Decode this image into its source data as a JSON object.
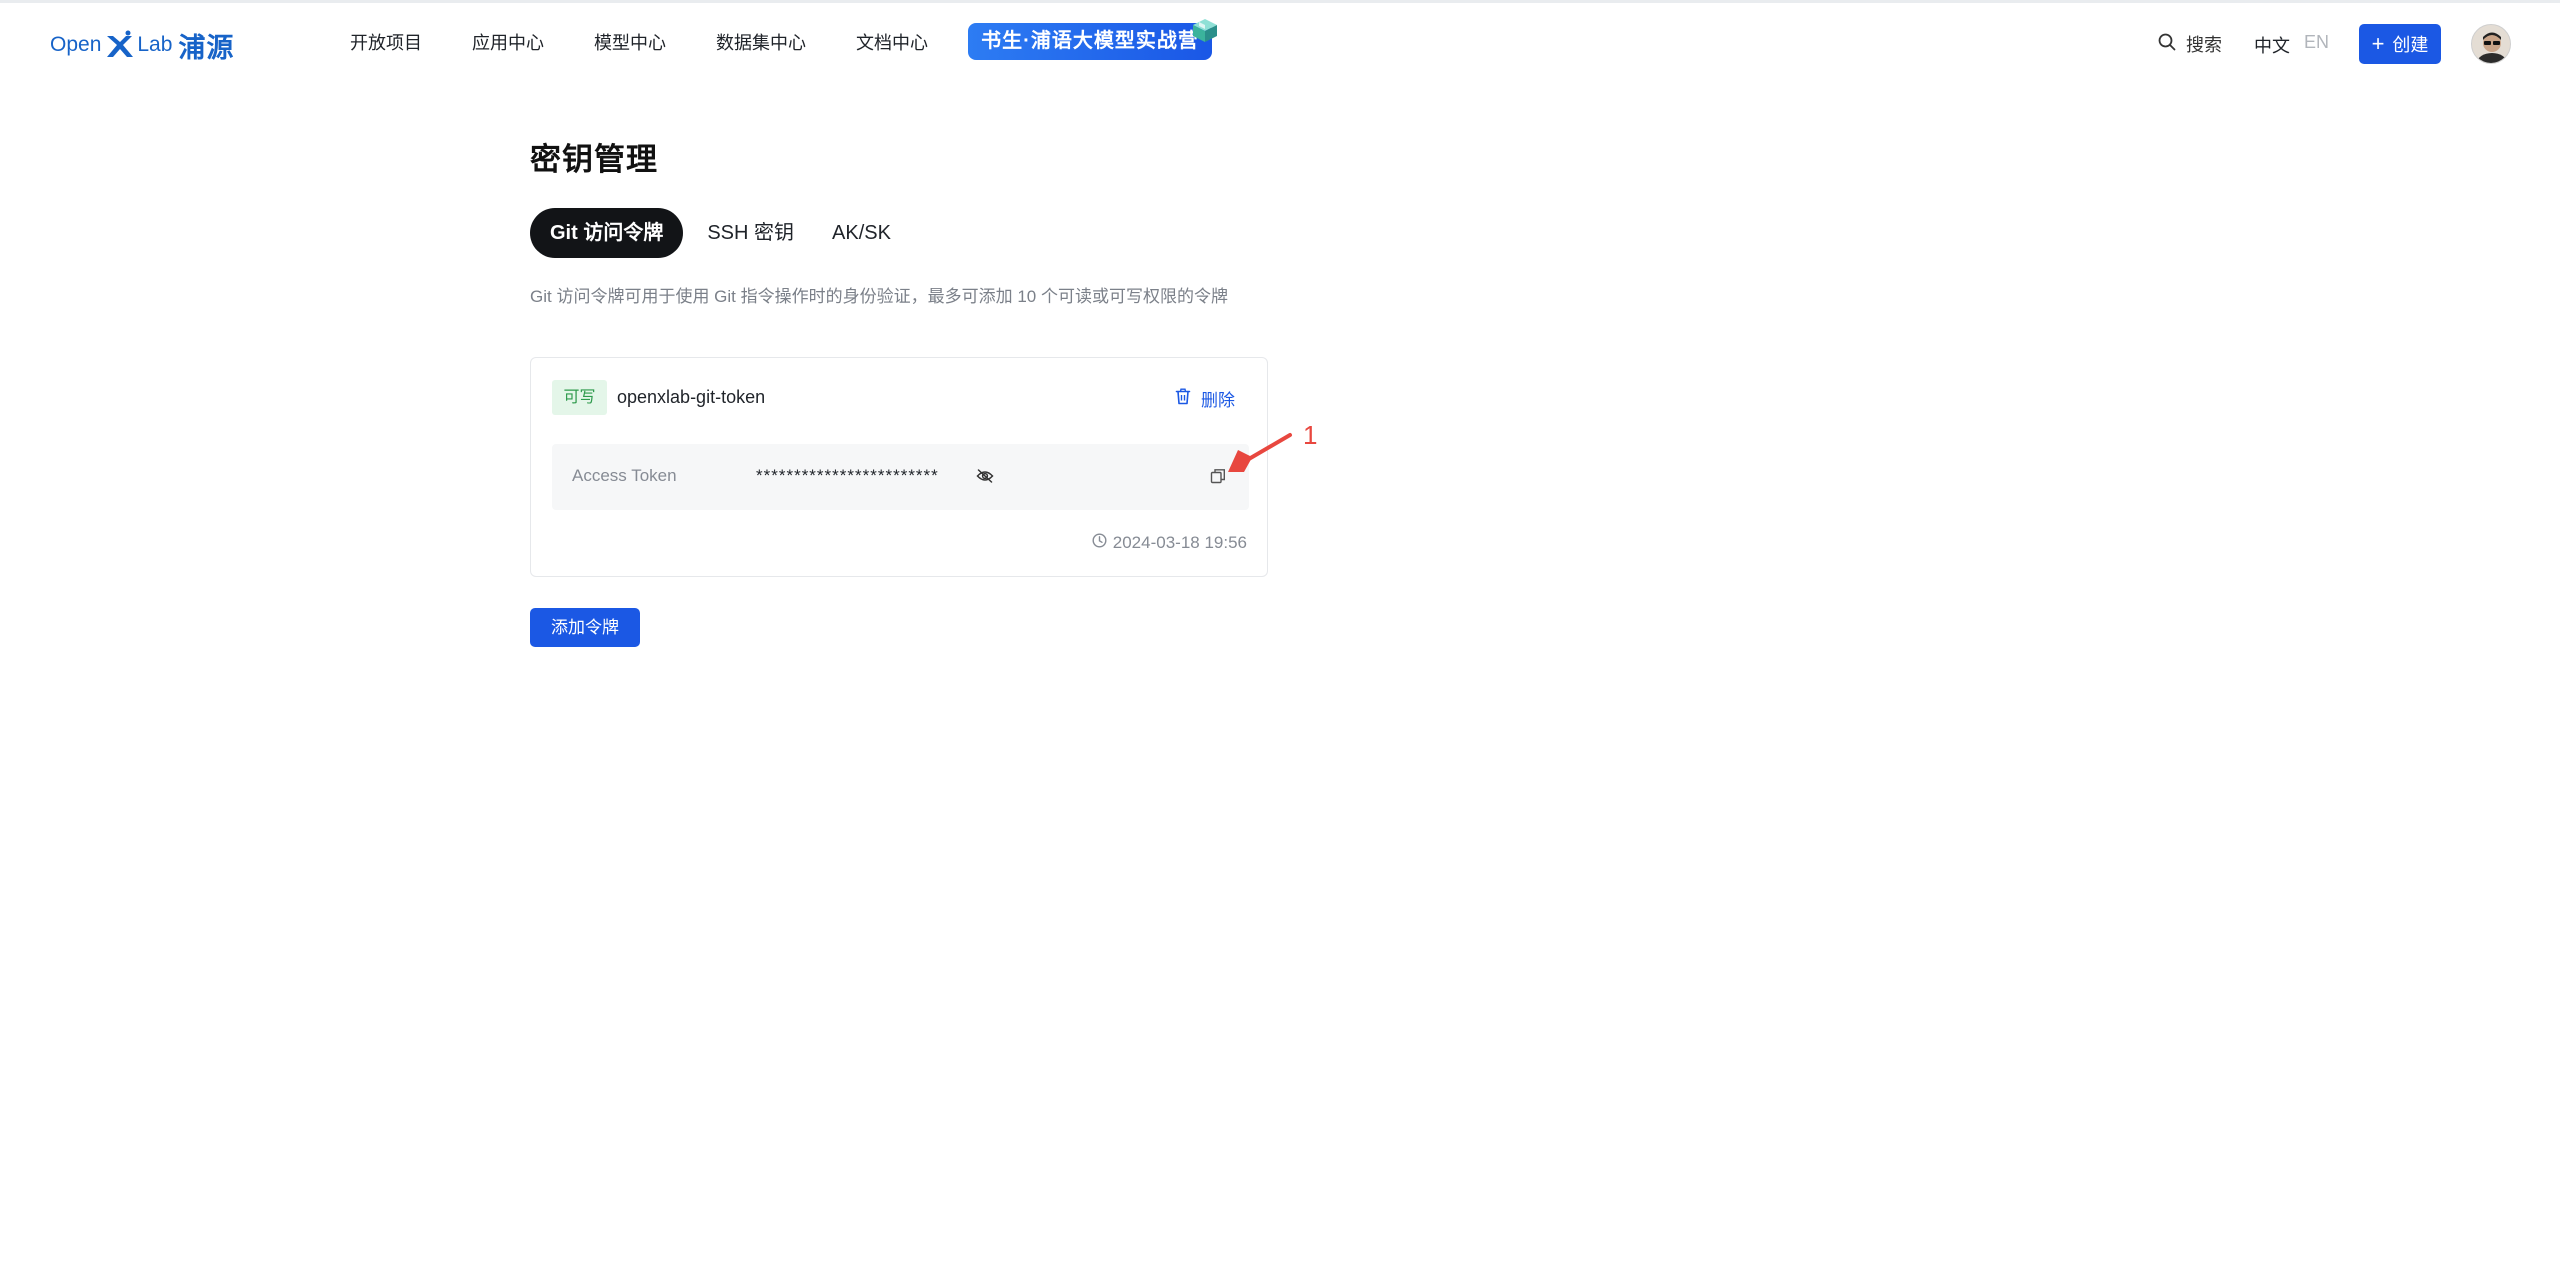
{
  "header": {
    "logo": {
      "open": "Open",
      "lab": "Lab",
      "cn": "浦源"
    },
    "nav": [
      {
        "label": "开放项目"
      },
      {
        "label": "应用中心"
      },
      {
        "label": "模型中心"
      },
      {
        "label": "数据集中心"
      },
      {
        "label": "文档中心"
      }
    ],
    "promo_label": "书生·浦语大模型实战营",
    "search_label": "搜索",
    "lang_zh": "中文",
    "lang_en": "EN",
    "create_label": "创建",
    "create_plus": "+"
  },
  "main": {
    "title": "密钥管理",
    "tabs": [
      {
        "label": "Git 访问令牌",
        "active": true
      },
      {
        "label": "SSH 密钥",
        "active": false
      },
      {
        "label": "AK/SK",
        "active": false
      }
    ],
    "description": "Git 访问令牌可用于使用 Git 指令操作时的身份验证，最多可添加 10 个可读或可写权限的令牌",
    "token": {
      "permission": "可写",
      "name": "openxlab-git-token",
      "delete_label": "删除",
      "access_label": "Access Token",
      "access_value": "************************",
      "created_at": "2024-03-18 19:56"
    },
    "add_button_label": "添加令牌"
  },
  "annotation": {
    "number": "1"
  },
  "colors": {
    "primary": "#1b58e4",
    "brand": "#1763c8",
    "badge_green": "#2e9a4c",
    "badge_green_bg": "#e4f6e9",
    "annotation_red": "#e8473f"
  },
  "icons": [
    "search-icon",
    "trash-icon",
    "eye-off-icon",
    "copy-icon",
    "clock-icon",
    "cube-icon"
  ]
}
